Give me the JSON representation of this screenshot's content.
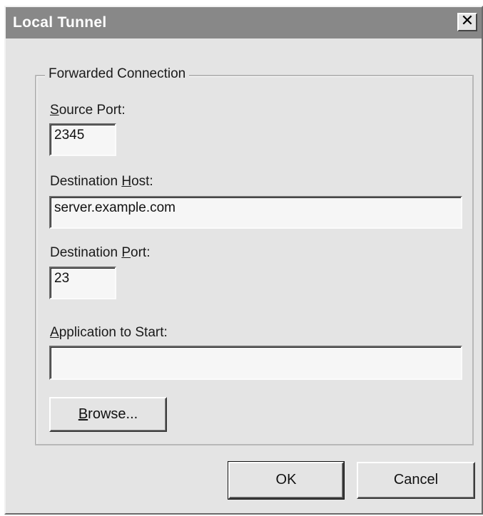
{
  "window": {
    "title": "Local Tunnel",
    "close_glyph": "✕"
  },
  "group": {
    "legend": "Forwarded Connection"
  },
  "fields": {
    "source_port": {
      "label_prefix": "",
      "mnemonic": "S",
      "label_suffix": "ource Port:",
      "value": "2345"
    },
    "destination_host": {
      "label_prefix": "Destination ",
      "mnemonic": "H",
      "label_suffix": "ost:",
      "value": "server.example.com"
    },
    "destination_port": {
      "label_prefix": "Destination ",
      "mnemonic": "P",
      "label_suffix": "ort:",
      "value": "23"
    },
    "application": {
      "label_prefix": "",
      "mnemonic": "A",
      "label_suffix": "pplication to Start:",
      "value": ""
    }
  },
  "buttons": {
    "browse": {
      "mnemonic": "B",
      "rest": "rowse..."
    },
    "ok": "OK",
    "cancel": "Cancel"
  }
}
